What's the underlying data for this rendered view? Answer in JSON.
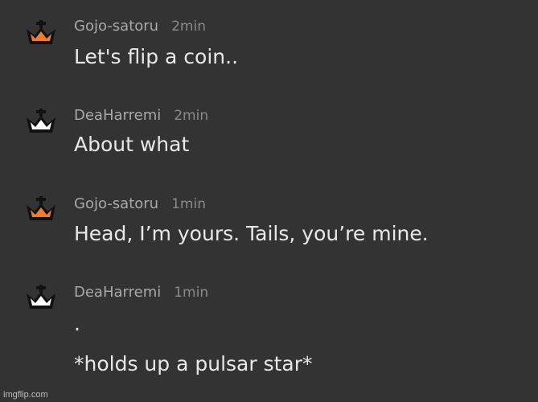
{
  "messages": [
    {
      "user": "Gojo-satoru",
      "time": "2min",
      "text": "Let's flip a coin..",
      "crown_color": "#f07d2c",
      "crown_icon": "crown-icon"
    },
    {
      "user": "DeaHarremi",
      "time": "2min",
      "text": "About what",
      "crown_color": "#ffffff",
      "crown_icon": "crown-icon"
    },
    {
      "user": "Gojo-satoru",
      "time": "1min",
      "text": "Head, I’m yours. Tails, you’re mine.",
      "crown_color": "#f07d2c",
      "crown_icon": "crown-icon"
    },
    {
      "user": "DeaHarremi",
      "time": "1min",
      "text": ".",
      "text2": "*holds up a pulsar star*",
      "crown_color": "#ffffff",
      "crown_icon": "crown-icon"
    }
  ],
  "watermark": "imgflip.com",
  "colors": {
    "background": "#333333",
    "username": "#a9a9a9",
    "timestamp": "#8a8a8a",
    "message_text": "#e8e8e8"
  }
}
